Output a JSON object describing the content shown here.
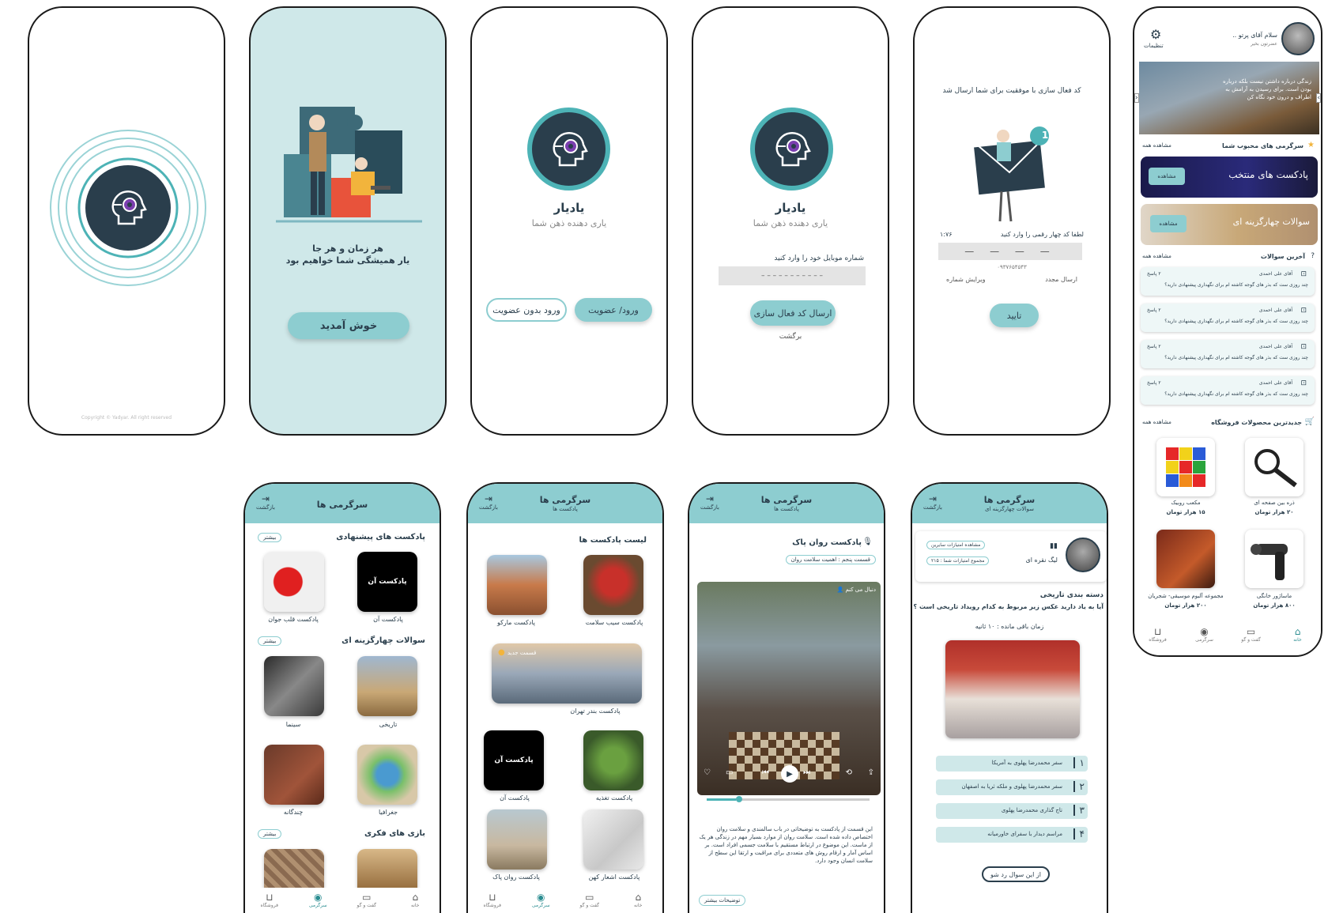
{
  "splash": {
    "copyright": "Copyright © Yadyar. All right reserved"
  },
  "onboarding": {
    "line1": "هر زمان و هر جا",
    "line2": "یار همیشگی شما خواهیم بود",
    "cta": "خوش آمدید"
  },
  "brand": {
    "name": "یادیار",
    "tagline": "یاری دهنده ذهن شما"
  },
  "auth": {
    "login_button": "ورود/ عضویت",
    "guest_button": "ورود بدون عضویت"
  },
  "phone_entry": {
    "label": "شماره موبایل خود را وارد کنید",
    "placeholder": "– – – – – – – – – – –",
    "submit": "ارسال کد فعال سازی",
    "back": "برگشت"
  },
  "verify": {
    "message": "کد فعال سازی با موفقیت برای شما ارسال شد",
    "badge": "1",
    "label": "لطفا کد چهار رقمی را وارد کنید",
    "timer": "۱:۷۶",
    "code_placeholder": "— — — —",
    "phone": "۰۹۳۷۶۵۴۵۴۳",
    "edit": "ویرایش شماره",
    "resend": "ارسال مجدد",
    "confirm": "تایید"
  },
  "home": {
    "greeting": "سلام آقای پرتو ..",
    "subtitle": "عضرتون بخیر",
    "settings": "تنظیمات",
    "banner_text": "زندگی درباره داشتن نیست بلکه درباره بودن است. برای رسیدن به آرامش به اطراف و درون خود نگاه کن",
    "fav_title": "سرگرمی های محبوب شما",
    "see_all": "مشاهده همه",
    "podcast_card": "پادکست های منتخب",
    "quiz_card": "سوالات چهارگزینه ای",
    "view": "مشاهده",
    "latest_q_title": "آخرین سوالات",
    "questions": [
      {
        "name": "آقای علی احمدی",
        "count": "۲ پاسخ",
        "text": "چند روزی ست که بذر های گوجه کاشته ام برای نگهداری پیشنهادی دارید؟"
      },
      {
        "name": "آقای علی احمدی",
        "count": "۲ پاسخ",
        "text": "چند روزی ست که بذر های گوجه کاشته ام برای نگهداری پیشنهادی دارید؟"
      },
      {
        "name": "آقای علی احمدی",
        "count": "۲ پاسخ",
        "text": "چند روزی ست که بذر های گوجه کاشته ام برای نگهداری پیشنهادی دارید؟"
      },
      {
        "name": "آقای علی احمدی",
        "count": "۲ پاسخ",
        "text": "چند روزی ست که بذر های گوجه کاشته ام برای نگهداری پیشنهادی دارید؟"
      }
    ],
    "shop_title": "جدیدترین محصولات فروشگاه",
    "products": [
      {
        "name": "ذره بین صفحه ای",
        "price": "۲۰ هزار تومان"
      },
      {
        "name": "مکعب روبیک",
        "price": "۱۵ هزار تومان"
      },
      {
        "name": "ماساژور خانگی",
        "price": "۸۰۰ هزار تومان"
      },
      {
        "name": "مجموعه آلبوم موسیقی- شجریان",
        "price": "۲۰۰ هزار تومان"
      }
    ]
  },
  "nav": {
    "home": "خانه",
    "chat": "گفت و گو",
    "fun": "سرگرمی",
    "shop": "فروشگاه"
  },
  "fun": {
    "title": "سرگرمی ها",
    "back": "بازگشت",
    "more": "بیشتر",
    "sec_podcast": "پادکست های پیشنهادی",
    "sec_quiz": "سوالات چهارگزینه ای",
    "sec_games": "بازی های فکری",
    "items": [
      "پادکست آن",
      "پادکست قلب جوان",
      "تاریخی",
      "سینما",
      "جغرافیا",
      "چندگانه"
    ]
  },
  "podcasts": {
    "title": "سرگرمی ها",
    "subtitle": "پادکست ها",
    "back": "بازگشت",
    "list_title": "لیست پادکست ها",
    "featured_badge": "قسمت جدید",
    "items": [
      "پادکست سیب سلامت",
      "پادکست مارکو",
      "پادکست بندر تهران",
      "پادکست تغذیه",
      "پادکست آن",
      "پادکست اشعار کهن",
      "پادکست روان پاک"
    ]
  },
  "player": {
    "title": "سرگرمی ها",
    "subtitle": "پادکست ها",
    "back": "بازگشت",
    "podcast_name": "پادکست روان پاک",
    "episode": "قسمت پنجم : اهمیت سلامت روان",
    "follow": "دنبال می کنم",
    "controls": [
      "حمایت",
      "نظر",
      "تکرار",
      "اشتراک"
    ],
    "description": "این قسمت از پادکست به توضیحاتی در باب سالمندی و سلامت روان اختصاص داده شده است. سلامت روان از موارد بسیار مهم در زندگی هر یک از ماست. این موضوع در ارتباط مستقیم با سلامت جسمی افراد است. بر اساس آمار و ارقام روش های متعددی برای مراقبت و ارتقا این سطح از سلامت انسان وجود دارد.",
    "more": "توضیحات بیشتر"
  },
  "quiz": {
    "title": "سرگرمی ها",
    "subtitle": "سوالات چهارگزینه ای",
    "back": "بازگشت",
    "league": "لیگ نقره ای",
    "others_btn": "مشاهده امتیازات سایرین",
    "score": "مجموع امتیازات شما : ۲۱۵",
    "category": "دسته بندی تاریخی",
    "question": "آیا به یاد دارید عکس زیر مربوط به کدام رویداد تاریخی است ؟",
    "timer": "زمان باقی مانده : ۱۰ ثانیه",
    "options": [
      {
        "num": "۱",
        "text": "سفر محمدرضا پهلوی به آمریکا"
      },
      {
        "num": "۲",
        "text": "سفر محمدرضا پهلوی و ملکه ثریا به اصفهان"
      },
      {
        "num": "۳",
        "text": "تاج گذاری محمدرضا پهلوی"
      },
      {
        "num": "۴",
        "text": "مراسم دیدار با سفرای خاورمیانه"
      }
    ],
    "skip": "از این سوال رد شو"
  },
  "colors": {
    "teal": "#8dcdd0",
    "navy": "#2a3e4c",
    "pale": "#cfe8e9"
  }
}
